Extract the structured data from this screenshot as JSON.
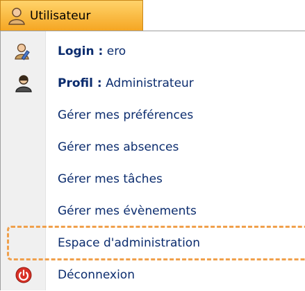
{
  "tab": {
    "label": "Utilisateur",
    "icon": "user-icon"
  },
  "menu": {
    "login": {
      "key": "Login :",
      "value": "ero",
      "icon": "user-edit-icon"
    },
    "profil": {
      "key": "Profil :",
      "value": "Administrateur",
      "icon": "user-profile-icon"
    },
    "items": [
      {
        "label": "Gérer mes préférences"
      },
      {
        "label": "Gérer mes absences"
      },
      {
        "label": "Gérer mes tâches"
      },
      {
        "label": "Gérer mes évènements"
      },
      {
        "label": "Espace d'administration"
      },
      {
        "label": "Déconnexion",
        "icon": "power-icon"
      }
    ]
  },
  "colors": {
    "tab": "#f5a623",
    "link_text": "#0b2c6e",
    "highlight": "#f0a04b",
    "power": "#d93025"
  }
}
